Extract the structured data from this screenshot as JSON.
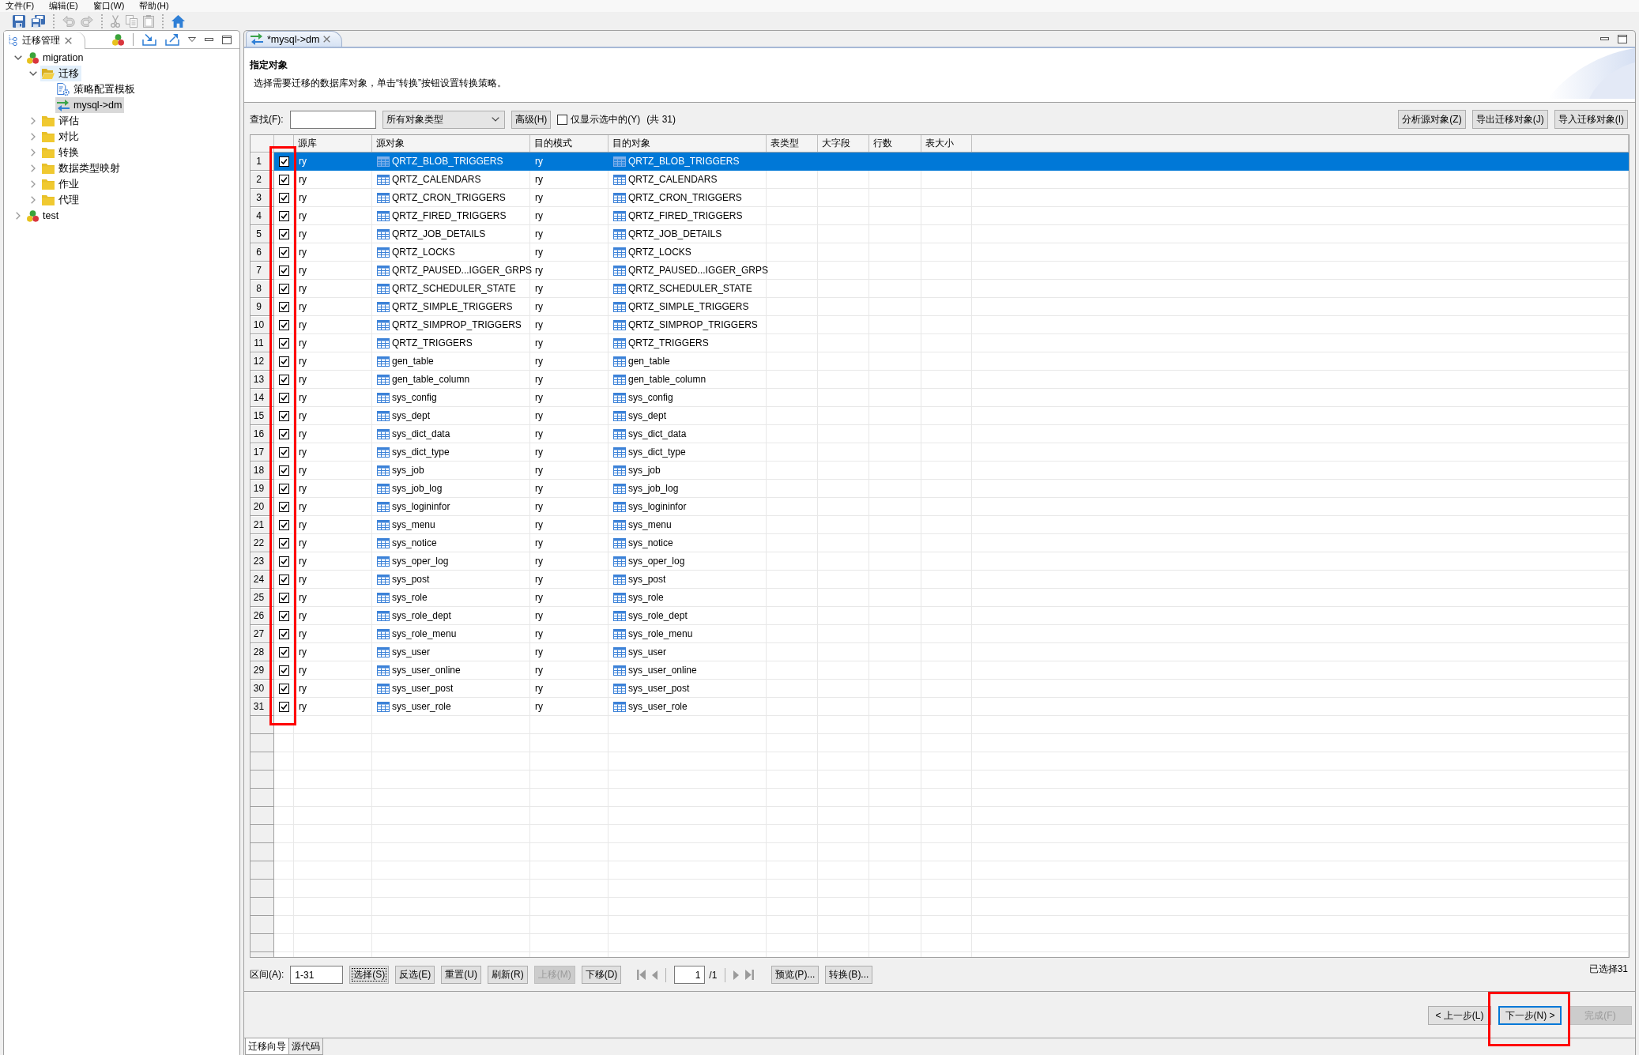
{
  "menu": [
    "文件(F)",
    "编辑(E)",
    "窗口(W)",
    "帮助(H)"
  ],
  "toolbar": [
    [
      {
        "kind": "save",
        "disabled": false
      },
      {
        "kind": "save_all",
        "disabled": false
      }
    ],
    [
      {
        "kind": "undo",
        "disabled": true
      },
      {
        "kind": "redo",
        "disabled": true
      }
    ],
    [
      {
        "kind": "cut",
        "disabled": true
      },
      {
        "kind": "copy",
        "disabled": true
      },
      {
        "kind": "paste",
        "disabled": true
      }
    ],
    [
      {
        "kind": "home",
        "disabled": false
      }
    ]
  ],
  "explorer": {
    "title": "迁移管理",
    "tree": [
      {
        "label": "migration",
        "kind": "project",
        "expanded": true,
        "selected": false,
        "hovered": false,
        "children": [
          {
            "label": "迁移",
            "kind": "folder",
            "expanded": true,
            "selected": false,
            "hovered": true,
            "children": [
              {
                "label": "策略配置模板",
                "kind": "template",
                "selected": false,
                "hovered": false
              },
              {
                "label": "mysql->dm",
                "kind": "migration",
                "selected": true,
                "hovered": false
              }
            ]
          },
          {
            "label": "评估",
            "kind": "folder",
            "expanded": false,
            "selected": false,
            "hovered": false
          },
          {
            "label": "对比",
            "kind": "folder",
            "expanded": false,
            "selected": false,
            "hovered": false
          },
          {
            "label": "转换",
            "kind": "folder",
            "expanded": false,
            "selected": false,
            "hovered": false
          },
          {
            "label": "数据类型映射",
            "kind": "folder",
            "expanded": false,
            "selected": false,
            "hovered": false
          },
          {
            "label": "作业",
            "kind": "folder",
            "expanded": false,
            "selected": false,
            "hovered": false
          },
          {
            "label": "代理",
            "kind": "folder",
            "expanded": false,
            "selected": false,
            "hovered": false
          }
        ]
      },
      {
        "label": "test",
        "kind": "project",
        "expanded": false,
        "selected": false,
        "hovered": false
      }
    ]
  },
  "editor": {
    "tab": "*mysql->dm",
    "page_title": "指定对象",
    "page_description": "选择需要迁移的数据库对象，单击“转换”按钮设置转换策略。",
    "filter": {
      "search_label": "查找(F):",
      "object_type": "所有对象类型",
      "advanced": "高级(H)",
      "only_selected": {
        "label": "仅显示选中的(Y)",
        "checked": false
      },
      "total": "(共 31)",
      "actions": [
        "分析源对象(Z)",
        "导出迁移对象(J)",
        "导入迁移对象(I)"
      ]
    },
    "table": {
      "columns": [
        "源库",
        "源对象",
        "目的模式",
        "目的对象",
        "表类型",
        "大字段",
        "行数",
        "表大小"
      ],
      "rows": [
        {
          "num": "1",
          "checked": true,
          "selected": true,
          "source_db": "ry",
          "source_object": "QRTZ_BLOB_TRIGGERS",
          "target_schema": "ry",
          "target_object": "QRTZ_BLOB_TRIGGERS"
        },
        {
          "num": "2",
          "checked": true,
          "selected": false,
          "source_db": "ry",
          "source_object": "QRTZ_CALENDARS",
          "target_schema": "ry",
          "target_object": "QRTZ_CALENDARS"
        },
        {
          "num": "3",
          "checked": true,
          "selected": false,
          "source_db": "ry",
          "source_object": "QRTZ_CRON_TRIGGERS",
          "target_schema": "ry",
          "target_object": "QRTZ_CRON_TRIGGERS"
        },
        {
          "num": "4",
          "checked": true,
          "selected": false,
          "source_db": "ry",
          "source_object": "QRTZ_FIRED_TRIGGERS",
          "target_schema": "ry",
          "target_object": "QRTZ_FIRED_TRIGGERS"
        },
        {
          "num": "5",
          "checked": true,
          "selected": false,
          "source_db": "ry",
          "source_object": "QRTZ_JOB_DETAILS",
          "target_schema": "ry",
          "target_object": "QRTZ_JOB_DETAILS"
        },
        {
          "num": "6",
          "checked": true,
          "selected": false,
          "source_db": "ry",
          "source_object": "QRTZ_LOCKS",
          "target_schema": "ry",
          "target_object": "QRTZ_LOCKS"
        },
        {
          "num": "7",
          "checked": true,
          "selected": false,
          "source_db": "ry",
          "source_object": "QRTZ_PAUSED...IGGER_GRPS",
          "target_schema": "ry",
          "target_object": "QRTZ_PAUSED...IGGER_GRPS"
        },
        {
          "num": "8",
          "checked": true,
          "selected": false,
          "source_db": "ry",
          "source_object": "QRTZ_SCHEDULER_STATE",
          "target_schema": "ry",
          "target_object": "QRTZ_SCHEDULER_STATE"
        },
        {
          "num": "9",
          "checked": true,
          "selected": false,
          "source_db": "ry",
          "source_object": "QRTZ_SIMPLE_TRIGGERS",
          "target_schema": "ry",
          "target_object": "QRTZ_SIMPLE_TRIGGERS"
        },
        {
          "num": "10",
          "checked": true,
          "selected": false,
          "source_db": "ry",
          "source_object": "QRTZ_SIMPROP_TRIGGERS",
          "target_schema": "ry",
          "target_object": "QRTZ_SIMPROP_TRIGGERS"
        },
        {
          "num": "11",
          "checked": true,
          "selected": false,
          "source_db": "ry",
          "source_object": "QRTZ_TRIGGERS",
          "target_schema": "ry",
          "target_object": "QRTZ_TRIGGERS"
        },
        {
          "num": "12",
          "checked": true,
          "selected": false,
          "source_db": "ry",
          "source_object": "gen_table",
          "target_schema": "ry",
          "target_object": "gen_table"
        },
        {
          "num": "13",
          "checked": true,
          "selected": false,
          "source_db": "ry",
          "source_object": "gen_table_column",
          "target_schema": "ry",
          "target_object": "gen_table_column"
        },
        {
          "num": "14",
          "checked": true,
          "selected": false,
          "source_db": "ry",
          "source_object": "sys_config",
          "target_schema": "ry",
          "target_object": "sys_config"
        },
        {
          "num": "15",
          "checked": true,
          "selected": false,
          "source_db": "ry",
          "source_object": "sys_dept",
          "target_schema": "ry",
          "target_object": "sys_dept"
        },
        {
          "num": "16",
          "checked": true,
          "selected": false,
          "source_db": "ry",
          "source_object": "sys_dict_data",
          "target_schema": "ry",
          "target_object": "sys_dict_data"
        },
        {
          "num": "17",
          "checked": true,
          "selected": false,
          "source_db": "ry",
          "source_object": "sys_dict_type",
          "target_schema": "ry",
          "target_object": "sys_dict_type"
        },
        {
          "num": "18",
          "checked": true,
          "selected": false,
          "source_db": "ry",
          "source_object": "sys_job",
          "target_schema": "ry",
          "target_object": "sys_job"
        },
        {
          "num": "19",
          "checked": true,
          "selected": false,
          "source_db": "ry",
          "source_object": "sys_job_log",
          "target_schema": "ry",
          "target_object": "sys_job_log"
        },
        {
          "num": "20",
          "checked": true,
          "selected": false,
          "source_db": "ry",
          "source_object": "sys_logininfor",
          "target_schema": "ry",
          "target_object": "sys_logininfor"
        },
        {
          "num": "21",
          "checked": true,
          "selected": false,
          "source_db": "ry",
          "source_object": "sys_menu",
          "target_schema": "ry",
          "target_object": "sys_menu"
        },
        {
          "num": "22",
          "checked": true,
          "selected": false,
          "source_db": "ry",
          "source_object": "sys_notice",
          "target_schema": "ry",
          "target_object": "sys_notice"
        },
        {
          "num": "23",
          "checked": true,
          "selected": false,
          "source_db": "ry",
          "source_object": "sys_oper_log",
          "target_schema": "ry",
          "target_object": "sys_oper_log"
        },
        {
          "num": "24",
          "checked": true,
          "selected": false,
          "source_db": "ry",
          "source_object": "sys_post",
          "target_schema": "ry",
          "target_object": "sys_post"
        },
        {
          "num": "25",
          "checked": true,
          "selected": false,
          "source_db": "ry",
          "source_object": "sys_role",
          "target_schema": "ry",
          "target_object": "sys_role"
        },
        {
          "num": "26",
          "checked": true,
          "selected": false,
          "source_db": "ry",
          "source_object": "sys_role_dept",
          "target_schema": "ry",
          "target_object": "sys_role_dept"
        },
        {
          "num": "27",
          "checked": true,
          "selected": false,
          "source_db": "ry",
          "source_object": "sys_role_menu",
          "target_schema": "ry",
          "target_object": "sys_role_menu"
        },
        {
          "num": "28",
          "checked": true,
          "selected": false,
          "source_db": "ry",
          "source_object": "sys_user",
          "target_schema": "ry",
          "target_object": "sys_user"
        },
        {
          "num": "29",
          "checked": true,
          "selected": false,
          "source_db": "ry",
          "source_object": "sys_user_online",
          "target_schema": "ry",
          "target_object": "sys_user_online"
        },
        {
          "num": "30",
          "checked": true,
          "selected": false,
          "source_db": "ry",
          "source_object": "sys_user_post",
          "target_schema": "ry",
          "target_object": "sys_user_post"
        },
        {
          "num": "31",
          "checked": true,
          "selected": false,
          "source_db": "ry",
          "source_object": "sys_user_role",
          "target_schema": "ry",
          "target_object": "sys_user_role"
        }
      ]
    },
    "range_bar": {
      "label": "区间(A):",
      "value": "1-31",
      "buttons": [
        {
          "label": "选择(S)",
          "focused": true,
          "disabled": false
        },
        {
          "label": "反选(E)",
          "focused": false,
          "disabled": false
        },
        {
          "label": "重置(U)",
          "focused": false,
          "disabled": false
        },
        {
          "label": "刷新(R)",
          "focused": false,
          "disabled": false
        },
        {
          "label": "上移(M)",
          "focused": false,
          "disabled": true
        },
        {
          "label": "下移(D)",
          "focused": false,
          "disabled": false
        }
      ],
      "page": "1",
      "page_total": "/1",
      "tools": [
        "预览(P)...",
        "转换(B)..."
      ]
    },
    "selected_count": "已选择31",
    "wizard_buttons": [
      {
        "label": "< 上一步(L)",
        "default": false,
        "disabled": false
      },
      {
        "label": "下一步(N) >",
        "default": true,
        "disabled": false
      },
      {
        "label": "完成(F)",
        "default": false,
        "disabled": true
      }
    ],
    "bottom_tabs": [
      {
        "label": "迁移向导",
        "selected": true
      },
      {
        "label": "源代码",
        "selected": false
      }
    ]
  }
}
